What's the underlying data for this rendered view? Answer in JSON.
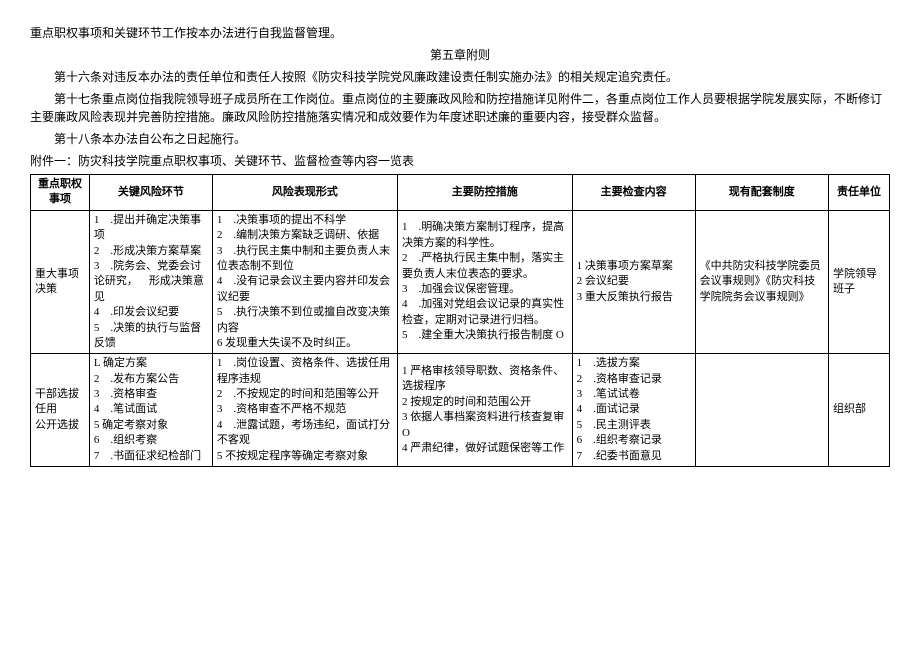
{
  "paragraphs": {
    "p1": "重点职权事项和关键环节工作按本办法进行自我监督管理。",
    "chapter": "第五章附则",
    "p16": "第十六条对违反本办法的责任单位和责任人按照《防灾科技学院党风廉政建设责任制实施办法》的相关规定追究责任。",
    "p17": "第十七条重点岗位指我院领导班子成员所在工作岗位。重点岗位的主要廉政风险和防控措施详见附件二，各重点岗位工作人员要根据学院发展实际，不断修订主要廉政风险表现并完善防控措施。廉政风险防控措施落实情况和成效要作为年度述职述廉的重要内容，接受群众监督。",
    "p18": "第十八条本办法自公布之日起施行。",
    "attachment": "附件一：防灾科技学院重点职权事项、关键环节、监督检查等内容一览表"
  },
  "table": {
    "headers": {
      "item": "重点职权事项",
      "link": "关键风险环节",
      "risk": "风险表现形式",
      "control": "主要防控措施",
      "check": "主要检查内容",
      "system": "现有配套制度",
      "unit": "责任单位"
    },
    "rows": [
      {
        "item": "重大事项决策",
        "link": "1 .提出并确定决策事项\n2 .形成决策方案草案\n3 .院务会、党委会讨论研究， 形成决策意见\n4 .印发会议纪要\n5 .决策的执行与监督反馈",
        "risk": "1 .决策事项的提出不科学\n2 .编制决策方案缺乏调研、依据\n3 .执行民主集中制和主要负责人末位表态制不到位\n4 .没有记录会议主要内容并印发会议纪要\n5 .执行决策不到位或擅自改变决策内容\n6 发现重大失误不及时纠正。",
        "control": "1 .明确决策方案制订程序，提高决策方案的科学性。\n2 .严格执行民主集中制，落实主要负责人末位表态的要求。\n3 .加强会议保密管理。\n4 .加强对党组会议记录的真实性检查，定期对记录进行归档。\n5 .建全重大决策执行报告制度 O",
        "check": "1 决策事项方案草案\n2 会议纪要\n3 重大反策执行报告",
        "system": "《中共防灾科技学院委员会议事规则》《防灾科技学院院务会议事规则》",
        "unit": "学院领导班子"
      },
      {
        "item": "干部选拔任用\n\n公开选拔",
        "link": "L 确定方案\n2 .发布方案公告\n3 .资格审查\n4 .笔试面试\n5 确定考察对象\n6 .组织考察\n7 .书面征求纪检部门",
        "risk": "1 .岗位设置、资格条件、选拔任用程序违规\n2 .不按规定的时间和范围等公开\n3 .资格审查不严格不规范\n4 .泄露试题，考场违纪，面试打分不客观\n5 不按规定程序等确定考察对象",
        "control": "1 严格审核领导职数、资格条件、选拔程序\n2 按规定的时间和范围公开\n3 依据人事档案资料进行核查复审 O\n4 严肃纪律，做好试题保密等工作",
        "check": "1 .选拔方案\n2 .资格审查记录\n3 .笔试试卷\n4 .面试记录\n5 .民主测评表\n6 .组织考察记录\n7 .纪委书面意见",
        "system": "",
        "unit": "组织部"
      }
    ]
  }
}
